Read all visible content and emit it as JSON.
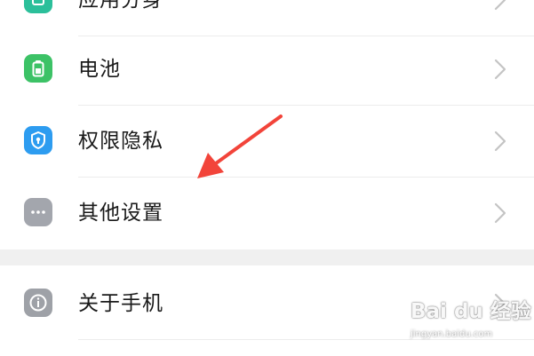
{
  "settings": {
    "items": [
      {
        "label": "应用分身",
        "icon": "app-clone-icon",
        "color": "#2bbf9a"
      },
      {
        "label": "电池",
        "icon": "battery-icon",
        "color": "#3cc266"
      },
      {
        "label": "权限隐私",
        "icon": "shield-lock-icon",
        "color": "#2d9cf0"
      },
      {
        "label": "其他设置",
        "icon": "more-dots-icon",
        "color": "#a3a6ad"
      },
      {
        "label": "关于手机",
        "icon": "info-icon",
        "color": "#9ea1a7"
      }
    ]
  },
  "annotation": {
    "arrow_color": "#f2443a"
  },
  "watermark": {
    "logo": "Bai du 经验",
    "url": "jingyan.baidu.com"
  }
}
